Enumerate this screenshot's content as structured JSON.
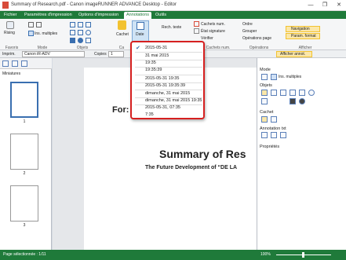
{
  "window": {
    "title": "Summary of Research.pdf - Canon imageRUNNER ADVANCE Desktop - Editor",
    "controls": [
      "—",
      "❐",
      "✕"
    ]
  },
  "tabs": [
    "Fichier",
    "Paramètres d'impression",
    "Options d'impression",
    "Annotations",
    "Outils"
  ],
  "ribbon": {
    "groups": [
      "Favoris",
      "Mode",
      "Objets",
      "Ca",
      "Cachets num.",
      "Opérations",
      "Afficher"
    ],
    "rising": "Rising",
    "ins_multiples": "Ins. multiples",
    "cachet": "Cachet",
    "date": "Date",
    "rech_texte": "Rech. texte",
    "cachets_num": "Cachets num.",
    "etat_signature": "État signature",
    "verifier": "Vérifier",
    "ordre": "Ordre",
    "grouper": "Grouper",
    "operations_page": "Opérations page",
    "navigation": "Navigation",
    "param_format": "Param. format",
    "afficher_annot": "Afficher annot."
  },
  "printer": {
    "label": "Imprim.",
    "value": "Canon iR-ADV",
    "copies_label": "Copies",
    "copies_value": "1",
    "page_value": "1",
    "search_label": "Rech"
  },
  "left": {
    "title": "Miniatures",
    "pages": [
      "1",
      "2",
      "3"
    ]
  },
  "doc": {
    "heading": "Summary of Res",
    "sub": "The Future Development of “DE LA",
    "for": "For:"
  },
  "right": {
    "mode": "Mode",
    "ins_multiples": "Ins. multiples",
    "objets": "Objets",
    "cachet": "Cachet",
    "annotation_txt": "Annotation txt",
    "proprietes": "Propriétés"
  },
  "dropdown": {
    "items": [
      "2015-05-31",
      "31 mai 2015",
      "19:35",
      "19:35:39",
      "2015-05-31 19:35",
      "2015-05-31 19:35:39",
      "dimanche, 31 mai 2015",
      "dimanche, 31 mai 2015 19:35",
      "2015-05-31, 07:35",
      "7:35"
    ],
    "selected_index": 0
  },
  "status": {
    "left": "Page sélectionnée : 1/11",
    "zoom": "100%"
  },
  "colors": {
    "accent": "#1f7a3a",
    "highlight": "#d62020",
    "nav_hl": "#f2c230"
  }
}
